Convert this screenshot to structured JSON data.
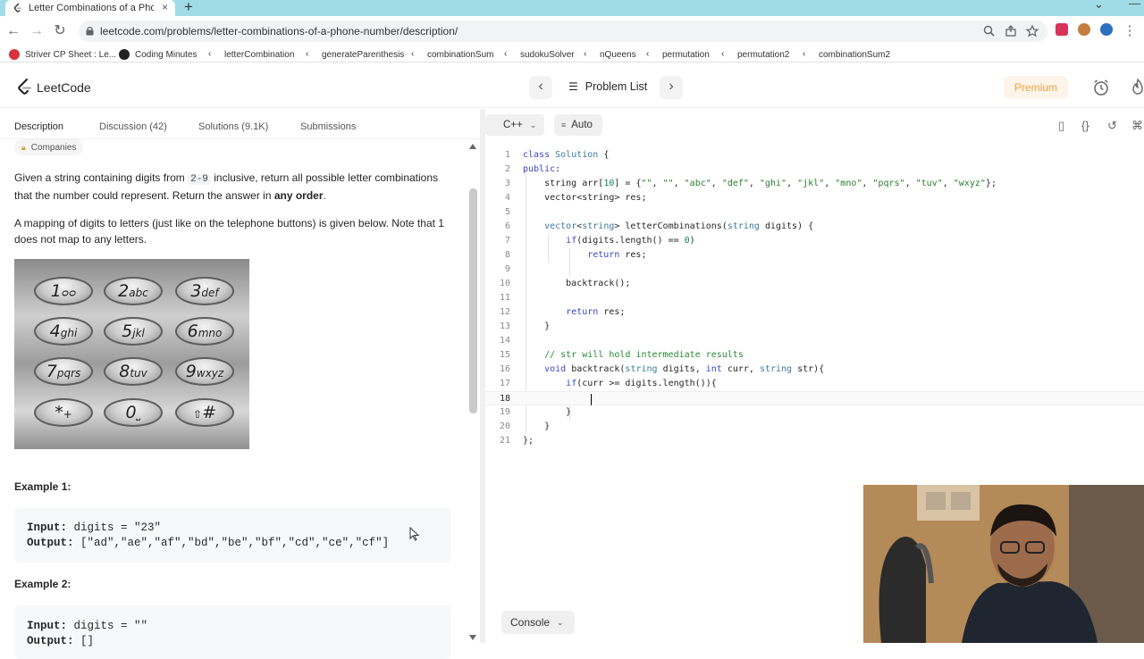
{
  "browser": {
    "tab_title": "Letter Combinations of a Phone",
    "tab_close": "×",
    "new_tab": "+",
    "url": "leetcode.com/problems/letter-combinations-of-a-phone-number/description/",
    "bookmarks": [
      {
        "label": "Striver CP Sheet : Le...",
        "icon": "striver-icon"
      },
      {
        "label": "Coding Minutes",
        "icon": "github-icon"
      },
      {
        "label": "letterCombination",
        "icon": "leetcode-icon"
      },
      {
        "label": "generateParenthesis",
        "icon": "leetcode-icon"
      },
      {
        "label": "combinationSum",
        "icon": "leetcode-icon"
      },
      {
        "label": "sudokuSolver",
        "icon": "leetcode-icon"
      },
      {
        "label": "nQueens",
        "icon": "leetcode-icon"
      },
      {
        "label": "permutation",
        "icon": "leetcode-icon"
      },
      {
        "label": "permutation2",
        "icon": "leetcode-icon"
      },
      {
        "label": "combinationSum2",
        "icon": "leetcode-icon"
      }
    ]
  },
  "header": {
    "brand": "LeetCode",
    "problem_list": "Problem List",
    "premium": "Premium"
  },
  "problem": {
    "tabs": [
      "Description",
      "Discussion (42)",
      "Solutions (9.1K)",
      "Submissions"
    ],
    "companies": "Companies",
    "desc_1a": "Given a string containing digits from ",
    "desc_1_code": "2-9",
    "desc_1b": " inclusive, return all possible letter combinations that the number could represent. Return the answer in ",
    "desc_1_bold": "any order",
    "desc_1c": ".",
    "desc_2": "A mapping of digits to letters (just like on the telephone buttons) is given below. Note that 1 does not map to any letters.",
    "keypad": [
      {
        "d": "1",
        "l": "ᴑᴑ"
      },
      {
        "d": "2",
        "l": "abc"
      },
      {
        "d": "3",
        "l": "def"
      },
      {
        "d": "4",
        "l": "ghi"
      },
      {
        "d": "5",
        "l": "jkl"
      },
      {
        "d": "6",
        "l": "mno"
      },
      {
        "d": "7",
        "l": "pqrs"
      },
      {
        "d": "8",
        "l": "tuv"
      },
      {
        "d": "9",
        "l": "wxyz"
      },
      {
        "d": "*",
        "l": "+"
      },
      {
        "d": "0",
        "l": "⎵"
      },
      {
        "d": "#",
        "l": "⇧"
      }
    ],
    "example1_title": "Example 1:",
    "example1_input_label": "Input:",
    "example1_input": " digits = \"23\"",
    "example1_output_label": "Output:",
    "example1_output": " [\"ad\",\"ae\",\"af\",\"bd\",\"be\",\"bf\",\"cd\",\"ce\",\"cf\"]",
    "example2_title": "Example 2:",
    "example2_input_label": "Input:",
    "example2_input": " digits = \"\"",
    "example2_output_label": "Output:",
    "example2_output": " []"
  },
  "editor": {
    "language": "C++",
    "auto": "Auto",
    "console": "Console",
    "line_numbers": [
      "1",
      "2",
      "3",
      "4",
      "5",
      "6",
      "7",
      "8",
      "9",
      "10",
      "11",
      "12",
      "13",
      "14",
      "15",
      "16",
      "17",
      "18",
      "19",
      "20",
      "21"
    ]
  },
  "colors": {
    "tab_bar": "#9fdce6",
    "premium_text": "#f0a040",
    "keyword": "#3b46c6",
    "string": "#2a7d2a",
    "comment": "#268a33"
  }
}
